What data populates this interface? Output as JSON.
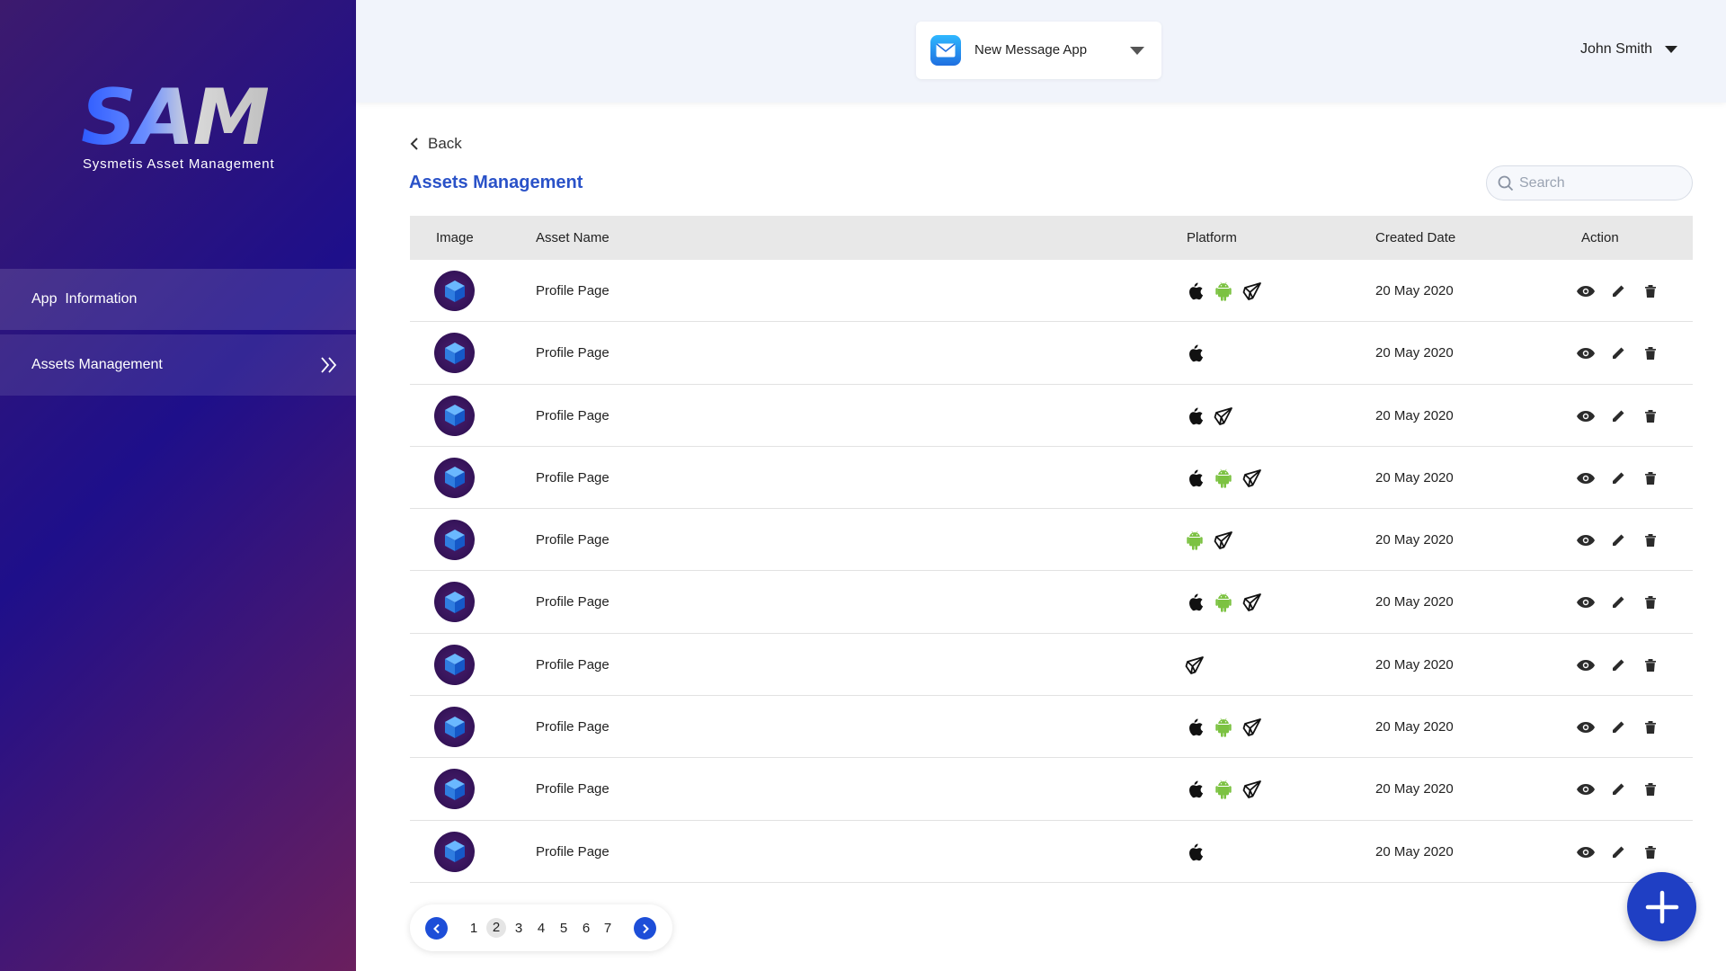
{
  "brand": {
    "logo_text": "SAM",
    "tagline": "Sysmetis Asset Management"
  },
  "sidebar": {
    "items": [
      {
        "label": "App  Information"
      },
      {
        "label": "Assets Management"
      }
    ]
  },
  "header": {
    "app_selector": {
      "value": "New Message App",
      "icon": "mail-icon"
    },
    "user": {
      "name": "John Smith"
    }
  },
  "main": {
    "back_label": "Back",
    "title": "Assets Management",
    "search": {
      "placeholder": "Search",
      "value": ""
    },
    "table": {
      "columns": [
        "Image",
        "Asset Name",
        "Platform",
        "Created Date",
        "Action"
      ],
      "rows": [
        {
          "name": "Profile Page",
          "platforms": [
            "apple",
            "android",
            "unity"
          ],
          "date": "20 May 2020"
        },
        {
          "name": "Profile Page",
          "platforms": [
            "apple"
          ],
          "date": "20 May 2020"
        },
        {
          "name": "Profile Page",
          "platforms": [
            "apple",
            "unity"
          ],
          "date": "20 May 2020"
        },
        {
          "name": "Profile Page",
          "platforms": [
            "apple",
            "android",
            "unity"
          ],
          "date": "20 May 2020"
        },
        {
          "name": "Profile Page",
          "platforms": [
            "android",
            "unity"
          ],
          "date": "20 May 2020"
        },
        {
          "name": "Profile Page",
          "platforms": [
            "apple",
            "android",
            "unity"
          ],
          "date": "20 May 2020"
        },
        {
          "name": "Profile Page",
          "platforms": [
            "unity"
          ],
          "date": "20 May 2020"
        },
        {
          "name": "Profile Page",
          "platforms": [
            "apple",
            "android",
            "unity"
          ],
          "date": "20 May 2020"
        },
        {
          "name": "Profile Page",
          "platforms": [
            "apple",
            "android",
            "unity"
          ],
          "date": "20 May 2020"
        },
        {
          "name": "Profile Page",
          "platforms": [
            "apple"
          ],
          "date": "20 May 2020"
        }
      ],
      "actions": [
        "view-icon",
        "edit-icon",
        "delete-icon"
      ]
    },
    "pagination": {
      "pages": [
        "1",
        "2",
        "3",
        "4",
        "5",
        "6",
        "7"
      ],
      "current": "2"
    }
  },
  "colors": {
    "accent": "#1d4ed8",
    "title": "#2a52c8",
    "android": "#7cc242",
    "fab": "#1f3fc4"
  }
}
